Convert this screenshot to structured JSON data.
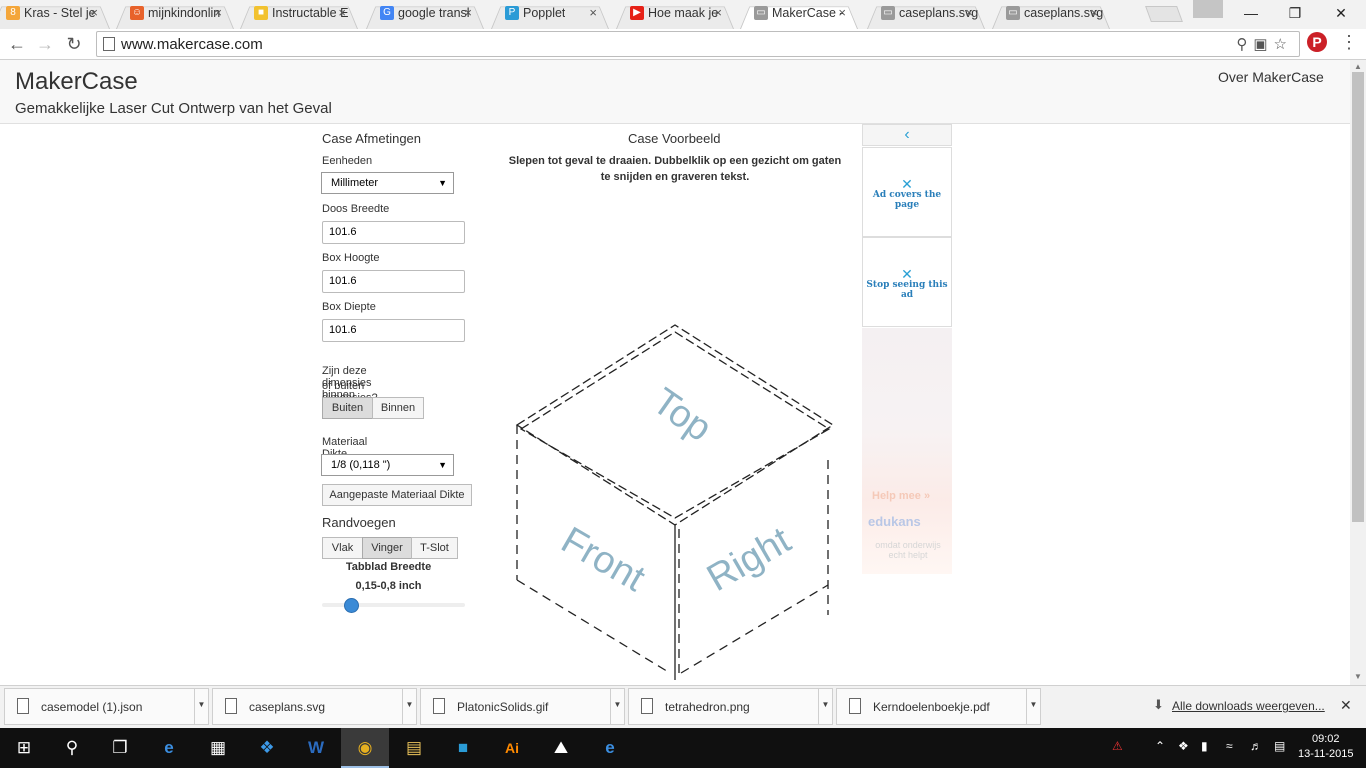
{
  "browser": {
    "tabs": [
      {
        "title": "Kras - Stel je",
        "color": "#f4a63a",
        "glyph": "8",
        "active": false
      },
      {
        "title": "mijnkindonlin",
        "color": "#e8622a",
        "glyph": "☺",
        "active": false
      },
      {
        "title": "Instructable E",
        "color": "#f2c230",
        "glyph": "■",
        "active": false
      },
      {
        "title": "google transl",
        "color": "#4285f4",
        "glyph": "G",
        "active": false
      },
      {
        "title": "Popplet",
        "color": "#2a9bd6",
        "glyph": "P",
        "active": false
      },
      {
        "title": "Hoe maak je",
        "color": "#e62117",
        "glyph": "▶",
        "active": false
      },
      {
        "title": "MakerCase -",
        "color": "#9a9a9a",
        "glyph": "▭",
        "active": true
      },
      {
        "title": "caseplans.svg",
        "color": "#9a9a9a",
        "glyph": "▭",
        "active": false
      },
      {
        "title": "caseplans.svg",
        "color": "#9a9a9a",
        "glyph": "▭",
        "active": false
      }
    ],
    "url": "www.makercase.com",
    "pinterest_glyph": "P"
  },
  "site": {
    "brand": "MakerCase",
    "tagline": "Gemakkelijke Laser Cut Ontwerp van het Geval",
    "about": "Over MakerCase"
  },
  "form": {
    "section_title": "Case Afmetingen",
    "units_label": "Eenheden",
    "units_value": "Millimeter",
    "width_label": "Doos Breedte",
    "width_value": "101.6",
    "height_label": "Box Hoogte",
    "height_value": "101.6",
    "depth_label": "Box Diepte",
    "depth_value": "101.6",
    "dims_question_1": "Zijn deze dimensies binnen",
    "dims_question_2": "of buiten dimensies?",
    "outside_label": "Buiten",
    "inside_label": "Binnen",
    "material_label": "Materiaal Dikte",
    "material_value": "1/8 (0,118 \")",
    "custom_material": "Aangepaste Materiaal Dikte",
    "edge_title": "Randvoegen",
    "edge_flat": "Vlak",
    "edge_finger": "Vinger",
    "edge_tslot": "T-Slot",
    "tab_width_label": "Tabblad Breedte",
    "tab_width_range": "0,15-0,8 inch",
    "tab_width_level": 0.2
  },
  "preview": {
    "title": "Case Voorbeeld",
    "hint": "Slepen tot geval te draaien. Dubbelklik op een gezicht om gaten te snijden en graveren tekst.",
    "face_top": "Top",
    "face_front": "Front",
    "face_right": "Right"
  },
  "ad": {
    "back": "‹",
    "covers": "Ad covers the page",
    "stop": "Stop seeing this ad",
    "help": "Help mee »",
    "logo": "edukans",
    "slogan": "omdat onderwijs echt helpt"
  },
  "downloads": {
    "items": [
      "casemodel (1).json",
      "caseplans.svg",
      "PlatonicSolids.gif",
      "tetrahedron.png",
      "Kerndoelenboekje.pdf"
    ],
    "show_all": "Alle downloads weergeven..."
  },
  "taskbar": {
    "time": "09:02",
    "date": "13-11-2015"
  }
}
